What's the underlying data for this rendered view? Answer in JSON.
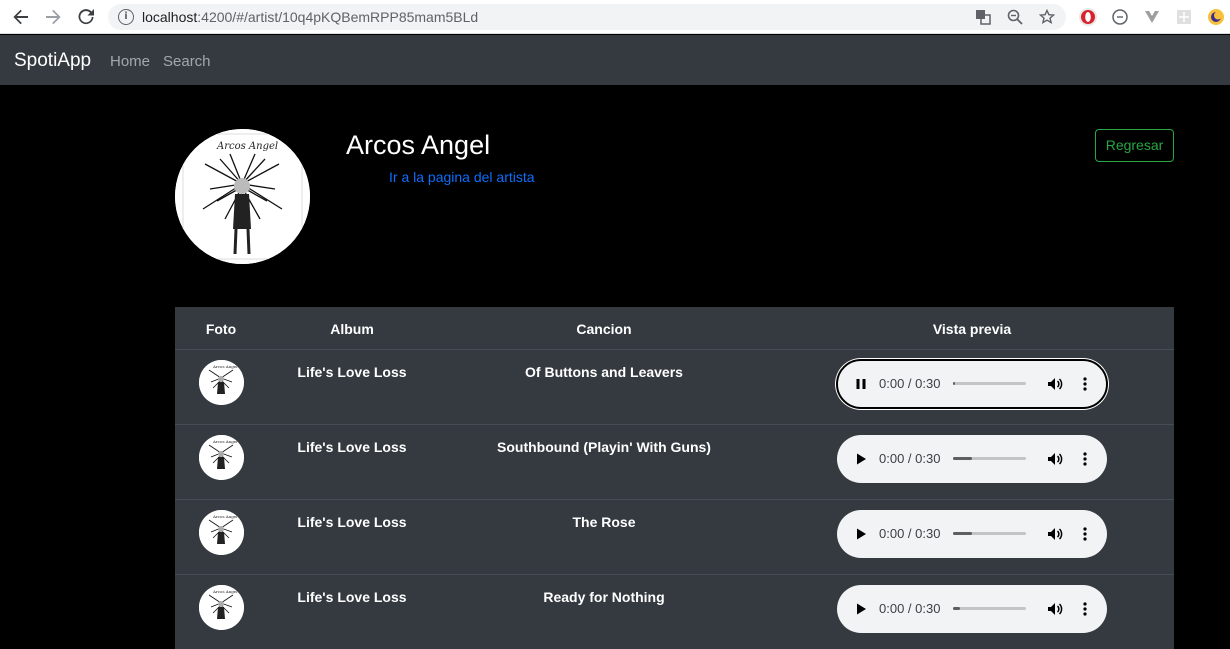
{
  "browser": {
    "url_host": "localhost",
    "url_path": ":4200/#/artist/10q4pKQBemRPP85mam5BLd"
  },
  "navbar": {
    "brand": "SpotiApp",
    "links": [
      "Home",
      "Search"
    ]
  },
  "artist": {
    "name": "Arcos Angel",
    "link_text": "Ir a la pagina del artista",
    "back_button": "Regresar"
  },
  "table": {
    "headers": [
      "Foto",
      "Album",
      "Cancion",
      "Vista previa"
    ],
    "rows": [
      {
        "album": "Life's Love Loss",
        "song": "Of Buttons and Leavers",
        "time": "0:00 / 0:30",
        "progress": 0.03,
        "playing": true
      },
      {
        "album": "Life's Love Loss",
        "song": "Southbound (Playin' With Guns)",
        "time": "0:00 / 0:30",
        "progress": 0.26,
        "playing": false
      },
      {
        "album": "Life's Love Loss",
        "song": "The Rose",
        "time": "0:00 / 0:30",
        "progress": 0.26,
        "playing": false
      },
      {
        "album": "Life's Love Loss",
        "song": "Ready for Nothing",
        "time": "0:00 / 0:30",
        "progress": 0.1,
        "playing": false
      }
    ]
  },
  "colors": {
    "navbar_bg": "#343a40",
    "table_bg": "#343a40",
    "link": "#0d6efd",
    "success": "#28a745",
    "page_bg": "#000000"
  }
}
